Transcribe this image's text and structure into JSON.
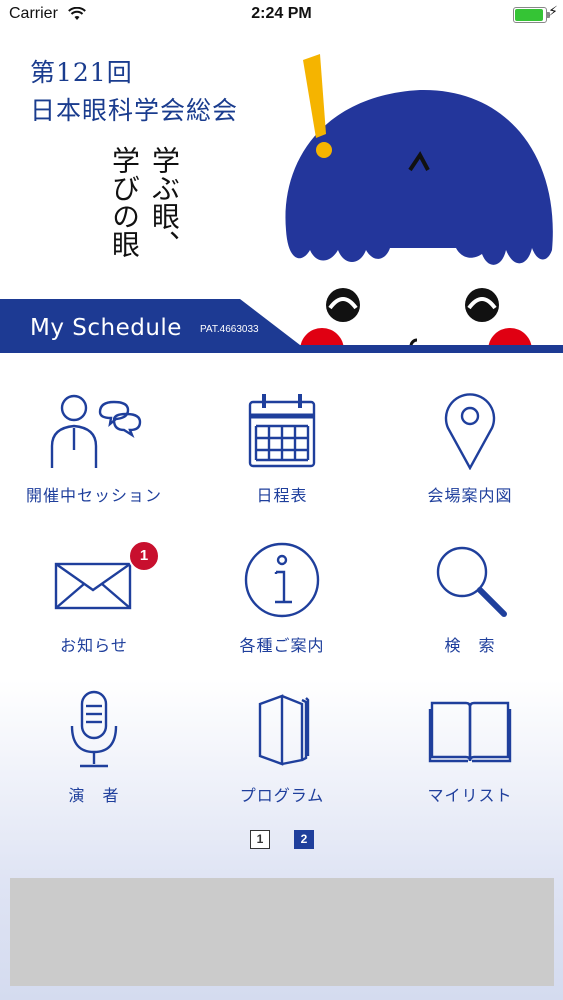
{
  "status_bar": {
    "carrier": "Carrier",
    "time": "2:24 PM",
    "battery_level": 0.95
  },
  "banner": {
    "title_line1": "第121回",
    "title_line2": "日本眼科学会総会",
    "slogan_col1": "学ぶ眼、",
    "slogan_col2": "学びの眼",
    "schedule_label": "My Schedule",
    "pat_label": "PAT.4663033"
  },
  "menu": {
    "items": [
      {
        "label": "開催中セッション",
        "icon": "speakers-icon"
      },
      {
        "label": "日程表",
        "icon": "calendar-icon"
      },
      {
        "label": "会場案内図",
        "icon": "map-pin-icon"
      },
      {
        "label": "お知らせ",
        "icon": "envelope-icon",
        "badge": "1"
      },
      {
        "label": "各種ご案内",
        "icon": "info-icon"
      },
      {
        "label": "検　索",
        "icon": "search-icon"
      },
      {
        "label": "演　者",
        "icon": "microphone-icon"
      },
      {
        "label": "プログラム",
        "icon": "booklet-icon"
      },
      {
        "label": "マイリスト",
        "icon": "open-book-icon"
      }
    ]
  },
  "pager": {
    "pages": [
      "1",
      "2"
    ],
    "current": "2"
  },
  "colors": {
    "brand_blue": "#1f3f9c",
    "badge_red": "#c8102e",
    "mascot_blue": "#23369b",
    "accent_yellow": "#f5b400"
  }
}
